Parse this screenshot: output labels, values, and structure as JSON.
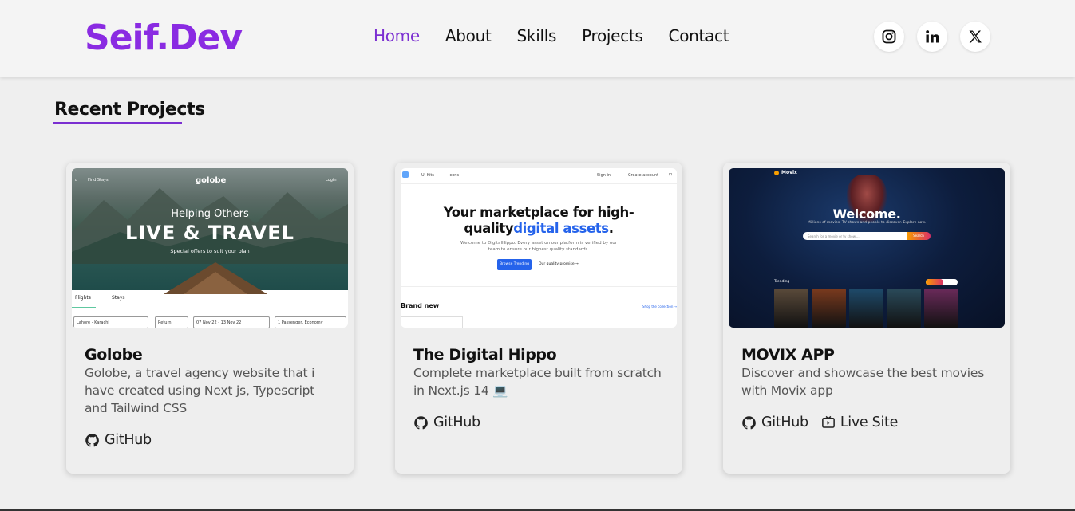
{
  "brand": {
    "logo": "Seif.Dev",
    "accent": "#8a2be2"
  },
  "nav": {
    "items": [
      {
        "label": "Home",
        "active": true
      },
      {
        "label": "About",
        "active": false
      },
      {
        "label": "Skills",
        "active": false
      },
      {
        "label": "Projects",
        "active": false
      },
      {
        "label": "Contact",
        "active": false
      }
    ]
  },
  "socials": [
    "instagram-icon",
    "linkedin-icon",
    "x-icon"
  ],
  "section": {
    "title": "Recent Projects"
  },
  "projects": [
    {
      "title": "Golobe",
      "description": "Golobe, a travel agency website that i have created using Next js, Typescript and Tailwind CSS",
      "links": [
        {
          "label": "GitHub",
          "icon": "github-icon"
        }
      ],
      "thumb": {
        "logo": "golobe",
        "nav_left": "Find Stays",
        "nav_right": "Login",
        "headline_small": "Helping Others",
        "headline_big": "LIVE & TRAVEL",
        "subline": "Special offers to suit your plan",
        "tab_flights": "Flights",
        "tab_stays": "Stays",
        "field_from": "Lahore - Karachi",
        "field_trip": "Return",
        "field_dates": "07 Nov 22 - 13 Nov 22",
        "field_passenger": "1 Passenger, Economy"
      }
    },
    {
      "title": "The Digital Hippo",
      "description": "Complete marketplace built from scratch in Next.js 14 💻",
      "links": [
        {
          "label": "GitHub",
          "icon": "github-icon"
        }
      ],
      "thumb": {
        "nav_ui_kits": "UI Kits",
        "nav_icons": "Icons",
        "sign_in": "Sign in",
        "create_account": "Create account",
        "headline_a": "Your marketplace for high-quality",
        "headline_b": "digital assets",
        "headline_end": ".",
        "paragraph": "Welcome to DigitalHippo. Every asset on our platform is verified by our team to ensure our highest quality standards.",
        "btn_primary": "Browse Trending",
        "btn_secondary": "Our quality promise →",
        "brand_new": "Brand new",
        "shop_link": "Shop the collection →"
      }
    },
    {
      "title": "MOVIX APP",
      "description": "Discover and showcase the best movies with Movix app",
      "links": [
        {
          "label": "GitHub",
          "icon": "github-icon"
        },
        {
          "label": "Live Site",
          "icon": "live-site-icon"
        }
      ],
      "thumb": {
        "logo": "Movix",
        "welcome": "Welcome.",
        "tagline": "Millions of movies, TV shows and people to discover. Explore now.",
        "search_placeholder": "Search for a movie or tv show....",
        "search_btn": "Search",
        "trending": "Trending",
        "posters": [
          "#5a4a3a",
          "#7a3a1e",
          "#1e4a6a",
          "#2a4a5a",
          "#6a2a5a"
        ]
      }
    }
  ]
}
